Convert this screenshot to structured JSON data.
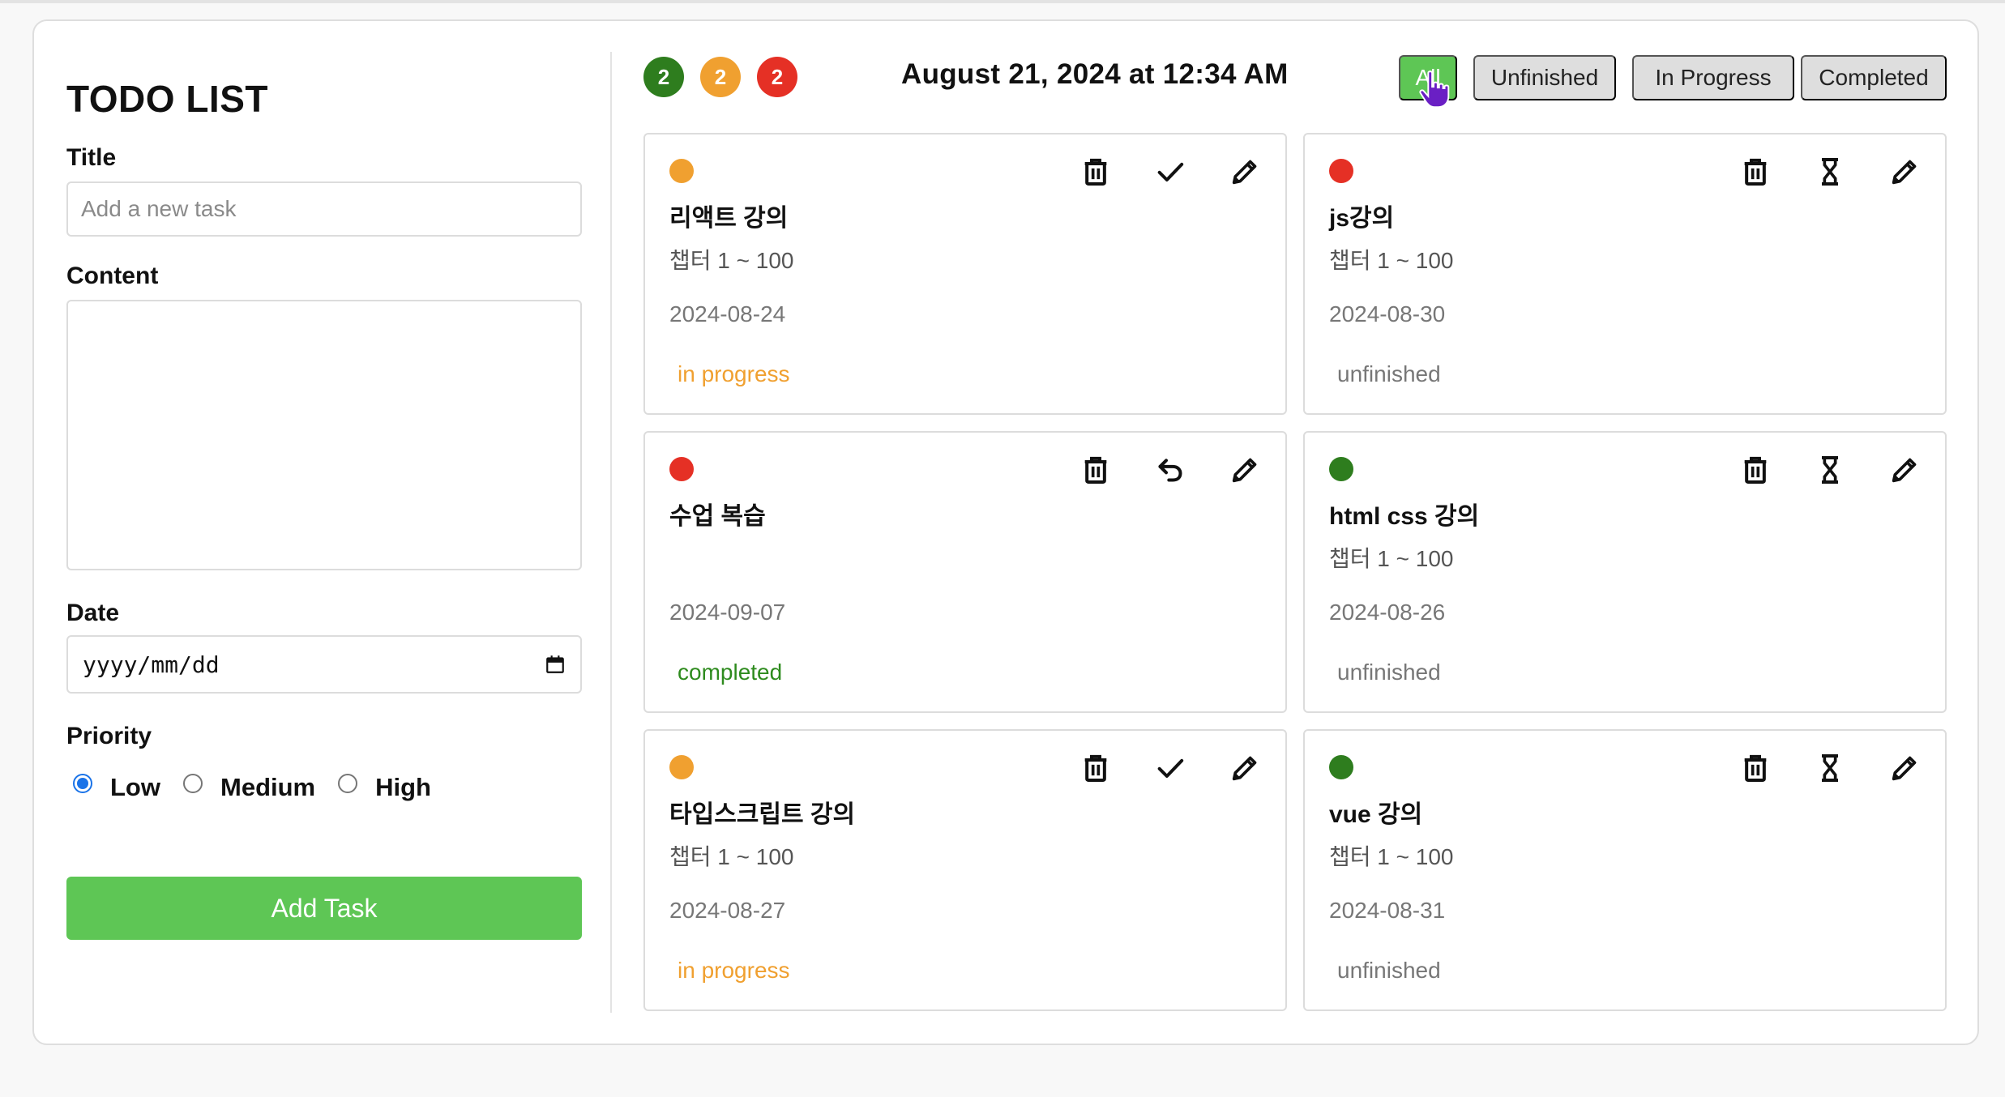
{
  "app": {
    "title": "TODO LIST"
  },
  "form": {
    "title_label": "Title",
    "title_placeholder": "Add a new task",
    "content_label": "Content",
    "content_value": "",
    "date_label": "Date",
    "date_placeholder": "yyyy/mm/dd",
    "priority_label": "Priority",
    "priority_options": [
      {
        "label": "Low",
        "checked": true
      },
      {
        "label": "Medium",
        "checked": false
      },
      {
        "label": "High",
        "checked": false
      }
    ],
    "submit_label": "Add Task"
  },
  "header": {
    "counters": [
      {
        "value": "2",
        "color": "#2e7d1e"
      },
      {
        "value": "2",
        "color": "#f0a030"
      },
      {
        "value": "2",
        "color": "#e53025"
      }
    ],
    "datetime": "August 21, 2024 at 12:34 AM",
    "filters": [
      {
        "label": "All",
        "active": true
      },
      {
        "label": "Unfinished",
        "active": false
      },
      {
        "label": "In Progress",
        "active": false
      },
      {
        "label": "Completed",
        "active": false
      }
    ]
  },
  "colors": {
    "accent": "#5ec655",
    "priority_low": "#2e7d1e",
    "priority_medium": "#f0a030",
    "priority_high": "#e53025",
    "status_in_progress": "#f0a030",
    "status_completed": "#2e8b1e",
    "status_unfinished": "#777777"
  },
  "tasks": [
    {
      "title": "리액트 강의",
      "content": "챕터 1 ~ 100",
      "date": "2024-08-24",
      "status": "in progress",
      "priority_color": "#f0a030",
      "status_color": "#f0a030",
      "action_icon": "check-icon"
    },
    {
      "title": "js강의",
      "content": "챕터 1 ~ 100",
      "date": "2024-08-30",
      "status": "unfinished",
      "priority_color": "#e53025",
      "status_color": "#777777",
      "action_icon": "hourglass-icon"
    },
    {
      "title": "수업 복습",
      "content": "",
      "date": "2024-09-07",
      "status": "completed",
      "priority_color": "#e53025",
      "status_color": "#2e8b1e",
      "action_icon": "undo-icon"
    },
    {
      "title": "html css 강의",
      "content": "챕터 1 ~ 100",
      "date": "2024-08-26",
      "status": "unfinished",
      "priority_color": "#2e7d1e",
      "status_color": "#777777",
      "action_icon": "hourglass-icon"
    },
    {
      "title": "타입스크립트 강의",
      "content": "챕터 1 ~ 100",
      "date": "2024-08-27",
      "status": "in progress",
      "priority_color": "#f0a030",
      "status_color": "#f0a030",
      "action_icon": "check-icon"
    },
    {
      "title": "vue 강의",
      "content": "챕터 1 ~ 100",
      "date": "2024-08-31",
      "status": "unfinished",
      "priority_color": "#2e7d1e",
      "status_color": "#777777",
      "action_icon": "hourglass-icon"
    }
  ]
}
